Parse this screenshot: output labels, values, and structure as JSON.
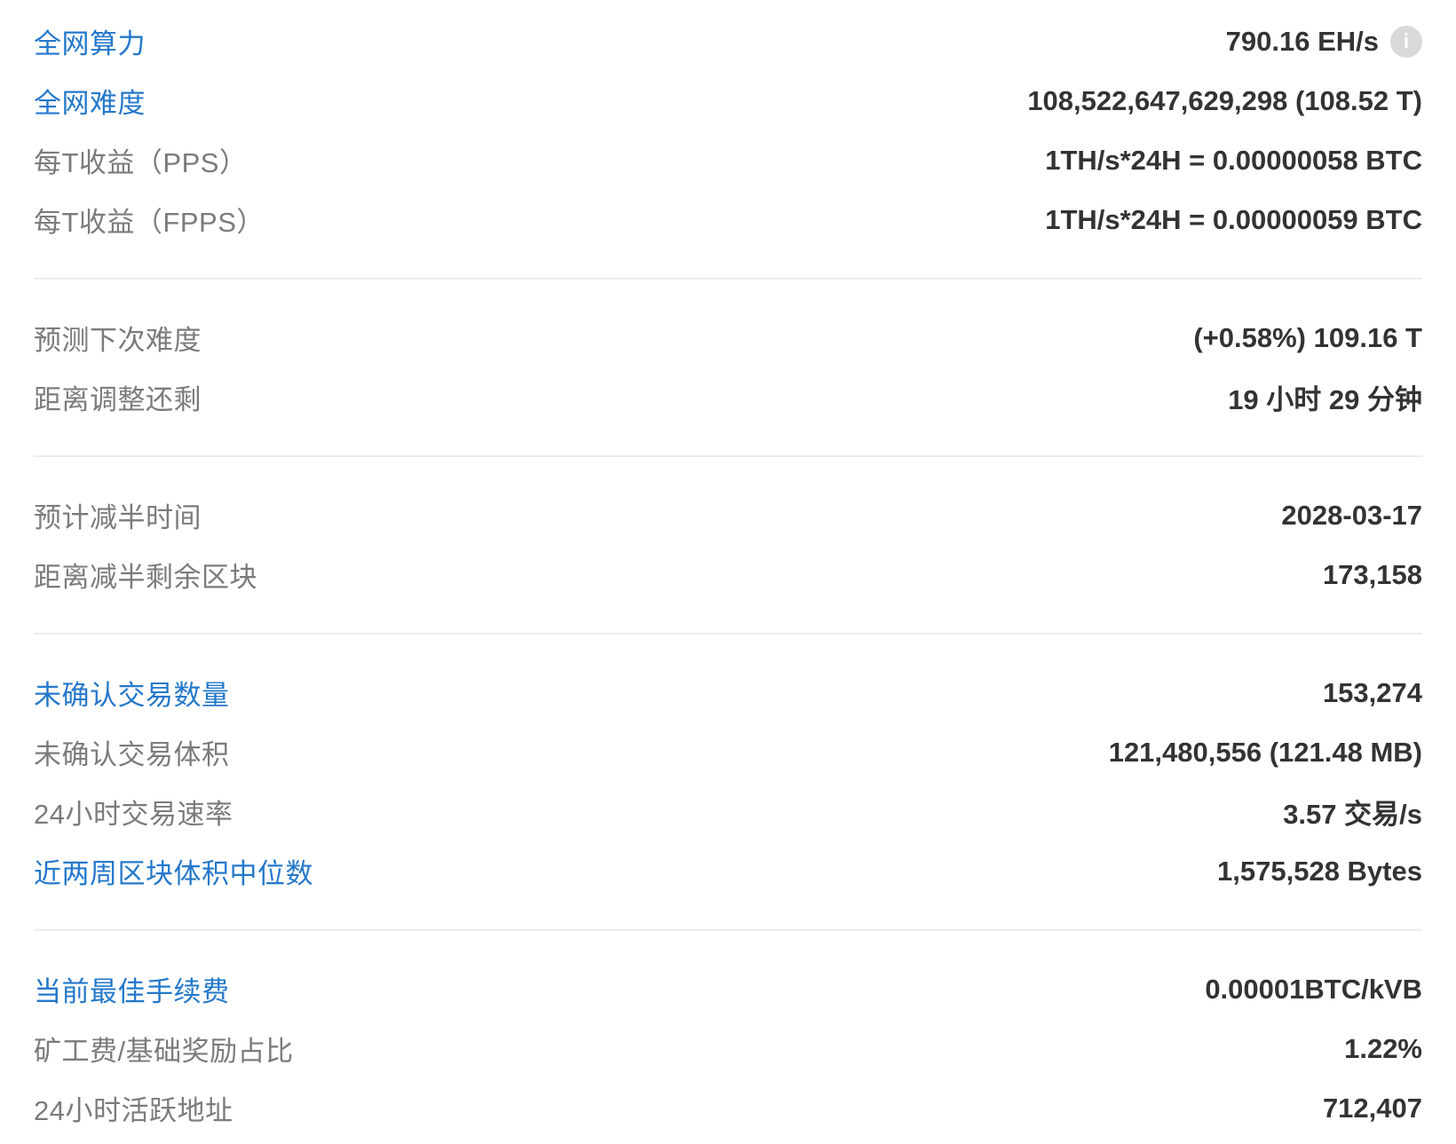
{
  "colors": {
    "link_blue": "#2478cb",
    "label_gray": "#7b7b7b",
    "value_dark": "#333333",
    "divider": "#ededed",
    "info_icon_bg": "#d9d9d9"
  },
  "info_icon_glyph": "i",
  "sections": [
    {
      "rows": [
        {
          "label": "全网算力",
          "value": "790.16 EH/s"
        },
        {
          "label": "全网难度",
          "value": "108,522,647,629,298 (108.52 T)"
        },
        {
          "label": "每T收益（PPS）",
          "value": "1TH/s*24H = 0.00000058 BTC"
        },
        {
          "label": "每T收益（FPPS）",
          "value": "1TH/s*24H = 0.00000059 BTC"
        }
      ]
    },
    {
      "rows": [
        {
          "label": "预测下次难度",
          "value": "(+0.58%) 109.16 T"
        },
        {
          "label": "距离调整还剩",
          "value": "19 小时 29 分钟"
        }
      ]
    },
    {
      "rows": [
        {
          "label": "预计减半时间",
          "value": "2028-03-17"
        },
        {
          "label": "距离减半剩余区块",
          "value": "173,158"
        }
      ]
    },
    {
      "rows": [
        {
          "label": "未确认交易数量",
          "value": "153,274"
        },
        {
          "label": "未确认交易体积",
          "value": "121,480,556 (121.48 MB)"
        },
        {
          "label": "24小时交易速率",
          "value": "3.57 交易/s"
        },
        {
          "label": "近两周区块体积中位数",
          "value": "1,575,528 Bytes"
        }
      ]
    },
    {
      "rows": [
        {
          "label": "当前最佳手续费",
          "value": "0.00001BTC/kVB"
        },
        {
          "label": "矿工费/基础奖励占比",
          "value": "1.22%"
        },
        {
          "label": "24小时活跃地址",
          "value": "712,407"
        }
      ]
    }
  ]
}
